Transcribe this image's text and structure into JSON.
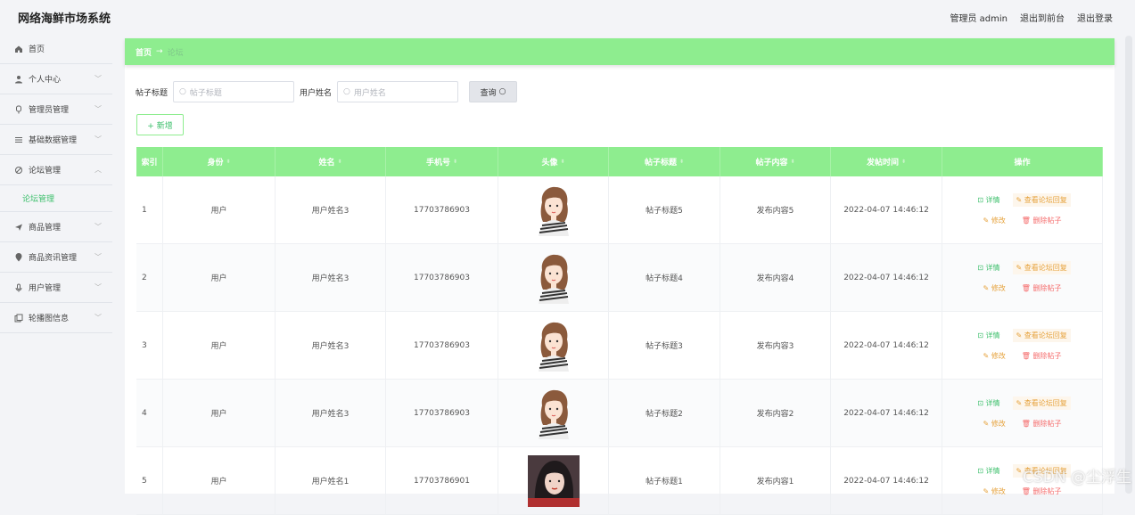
{
  "app": {
    "title": "网络海鲜市场系统"
  },
  "topnav": {
    "user": "管理员 admin",
    "to_front": "退出到前台",
    "logout": "退出登录"
  },
  "sidebar": {
    "items": [
      {
        "label": "首页",
        "icon": "home-icon"
      },
      {
        "label": "个人中心",
        "icon": "user-icon"
      },
      {
        "label": "管理员管理",
        "icon": "admin-icon"
      },
      {
        "label": "基础数据管理",
        "icon": "sliders-icon"
      },
      {
        "label": "论坛管理",
        "icon": "forum-icon",
        "sub": "论坛管理"
      },
      {
        "label": "商品管理",
        "icon": "plane-icon"
      },
      {
        "label": "商品资讯管理",
        "icon": "pin-icon"
      },
      {
        "label": "用户管理",
        "icon": "mic-icon"
      },
      {
        "label": "轮播图信息",
        "icon": "copy-icon"
      }
    ]
  },
  "breadcrumb": {
    "home": "首页",
    "sep": "→",
    "current": "论坛"
  },
  "search": {
    "title_label": "帖子标题",
    "title_placeholder": "帖子标题",
    "user_label": "用户姓名",
    "user_placeholder": "用户姓名",
    "button": "查询"
  },
  "add_button": "+ 新增",
  "table": {
    "headers": [
      "索引",
      "身份",
      "姓名",
      "手机号",
      "头像",
      "帖子标题",
      "帖子内容",
      "发帖时间",
      "操作"
    ],
    "rows": [
      {
        "idx": "1",
        "role": "用户",
        "name": "用户姓名3",
        "phone": "17703786903",
        "avatar": "cartoon-girl",
        "title": "帖子标题5",
        "content": "发布内容5",
        "time": "2022-04-07 14:46:12"
      },
      {
        "idx": "2",
        "role": "用户",
        "name": "用户姓名3",
        "phone": "17703786903",
        "avatar": "cartoon-girl",
        "title": "帖子标题4",
        "content": "发布内容4",
        "time": "2022-04-07 14:46:12"
      },
      {
        "idx": "3",
        "role": "用户",
        "name": "用户姓名3",
        "phone": "17703786903",
        "avatar": "cartoon-girl",
        "title": "帖子标题3",
        "content": "发布内容3",
        "time": "2022-04-07 14:46:12"
      },
      {
        "idx": "4",
        "role": "用户",
        "name": "用户姓名3",
        "phone": "17703786903",
        "avatar": "cartoon-girl",
        "title": "帖子标题2",
        "content": "发布内容2",
        "time": "2022-04-07 14:46:12"
      },
      {
        "idx": "5",
        "role": "用户",
        "name": "用户姓名1",
        "phone": "17703786901",
        "avatar": "photo-woman",
        "title": "帖子标题1",
        "content": "发布内容1",
        "time": "2022-04-07 14:46:12"
      }
    ],
    "ops": {
      "detail": "详情",
      "view": "查看论坛回复",
      "edit": "修改",
      "del": "删除帖子"
    }
  },
  "watermark": "CSDN @尘浮生",
  "colors": {
    "accent": "#8eed8f",
    "green_text": "#3cbf6b",
    "warning": "#e6a23c",
    "danger": "#f56c6c"
  }
}
